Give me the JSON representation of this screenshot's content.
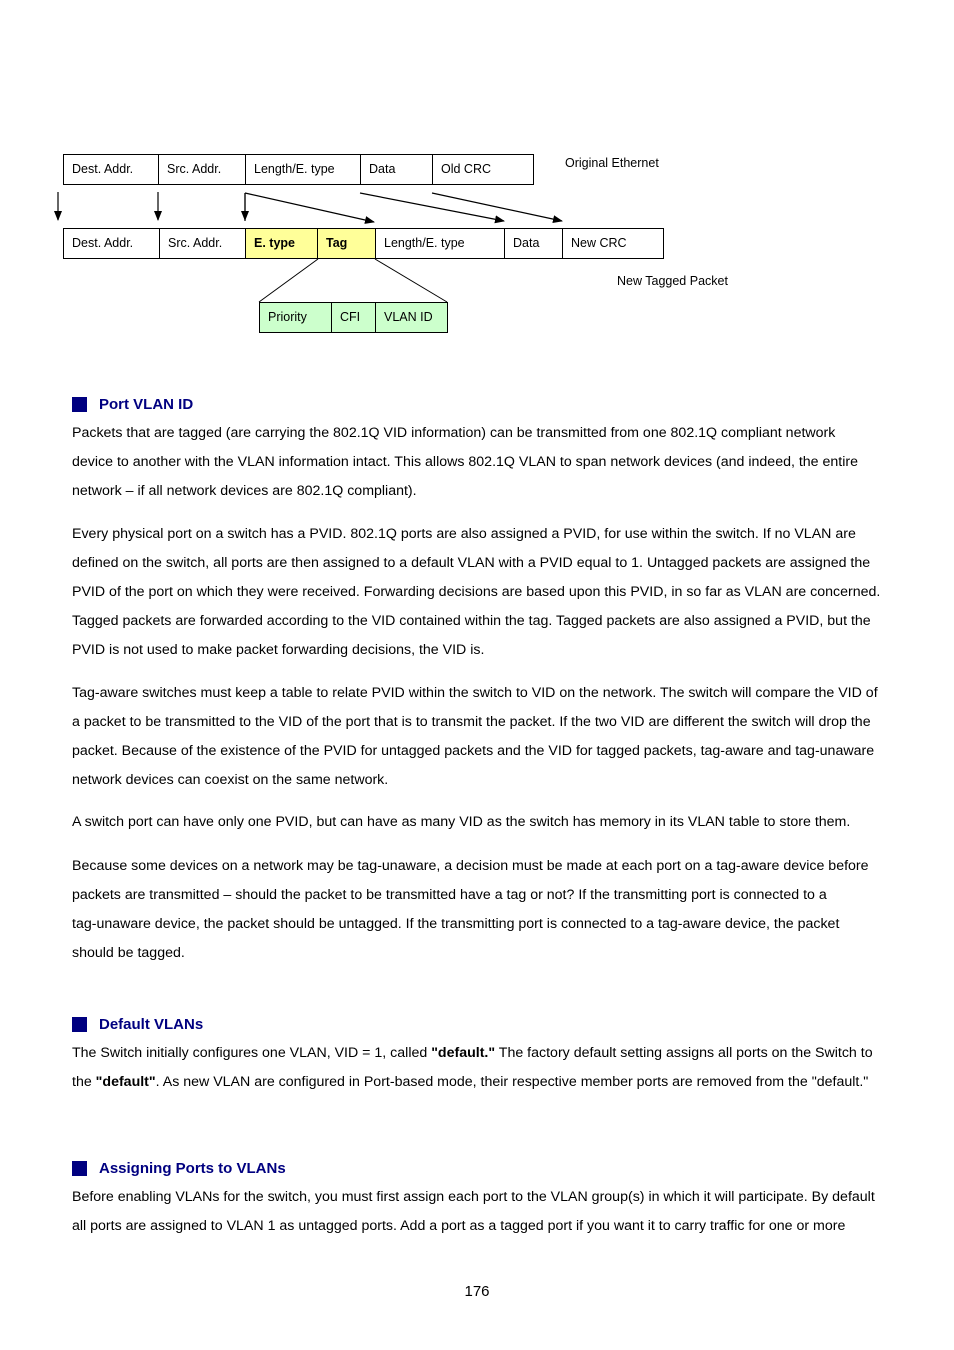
{
  "diagram": {
    "original_label": "Original Ethernet",
    "tagged_label": "New Tagged Packet",
    "original_fields": [
      "Dest. Addr.",
      "Src. Addr.",
      "Length/E. type",
      "Data",
      "Old CRC"
    ],
    "tagged_fields": [
      "Dest. Addr.",
      "Src. Addr.",
      "E. type",
      "Tag",
      "Length/E. type",
      "Data",
      "New CRC"
    ],
    "tag_fields": [
      "Priority",
      "CFI",
      "VLAN ID"
    ],
    "colors": {
      "inserted": "#ffff99",
      "tag_detail": "#ccffcc"
    }
  },
  "sections": [
    {
      "title": "Port VLAN ID",
      "paragraphs": [
        [
          "Packets that are tagged (are carrying the 802.1Q VID information) can be transmitted from one 802.1Q compliant network",
          "device to another with the VLAN information intact. This allows 802.1Q VLAN to span network devices (and indeed, the entire",
          "network – if all network devices are 802.1Q compliant)."
        ],
        [
          "Every physical port on a switch has a PVID. 802.1Q ports are also assigned a PVID, for use within the switch. If no VLAN are",
          "defined on the switch, all ports are then assigned to a default VLAN with a PVID equal to 1. Untagged packets are assigned the",
          "PVID of the port on which they were received. Forwarding decisions are based upon this PVID, in so far as VLAN are concerned.",
          "Tagged packets are forwarded according to the VID contained within the tag. Tagged packets are also assigned a PVID, but the",
          "PVID is not used to make packet forwarding decisions, the VID is."
        ],
        [
          "Tag-aware switches must keep a table to relate PVID within the switch to VID on the network. The switch will compare the VID of",
          "a packet to be transmitted to the VID of the port that is to transmit the packet. If the two VID are different the switch will drop the",
          "packet. Because of the existence of the PVID for untagged packets and the VID for tagged packets, tag-aware and tag-unaware",
          "network devices can coexist on the same network."
        ],
        [
          "A switch port can have only one PVID, but can have as many VID as the switch has memory in its VLAN table to store them."
        ],
        [
          "Because some devices on a network may be tag-unaware, a decision must be made at each port on a tag-aware device before",
          "packets are transmitted – should the packet to be transmitted have a tag or not? If the transmitting port is connected to a",
          "tag-unaware device, the packet should be untagged. If the transmitting port is connected to a tag-aware device, the packet",
          "should be tagged."
        ]
      ]
    },
    {
      "title": "Default VLANs",
      "line1": {
        "a": "The Switch initially configures one VLAN, VID = 1, called ",
        "b": "\"default.\"",
        "c": " The factory default setting assigns all ports on the Switch to"
      },
      "line2": {
        "a": "the ",
        "b": "\"default\"",
        "c": ". As new VLAN are configured in Port-based mode, their respective member ports are removed from the \"default.\""
      }
    },
    {
      "title": "Assigning Ports to VLANs",
      "paragraphs": [
        [
          "Before enabling VLANs for the switch, you must first assign each port to the VLAN group(s) in which it will participate. By default",
          "all ports are assigned to VLAN 1 as untagged ports. Add a port as a tagged port if you want it to carry traffic for one or more"
        ]
      ]
    }
  ],
  "footer": {
    "page_number": "176"
  }
}
